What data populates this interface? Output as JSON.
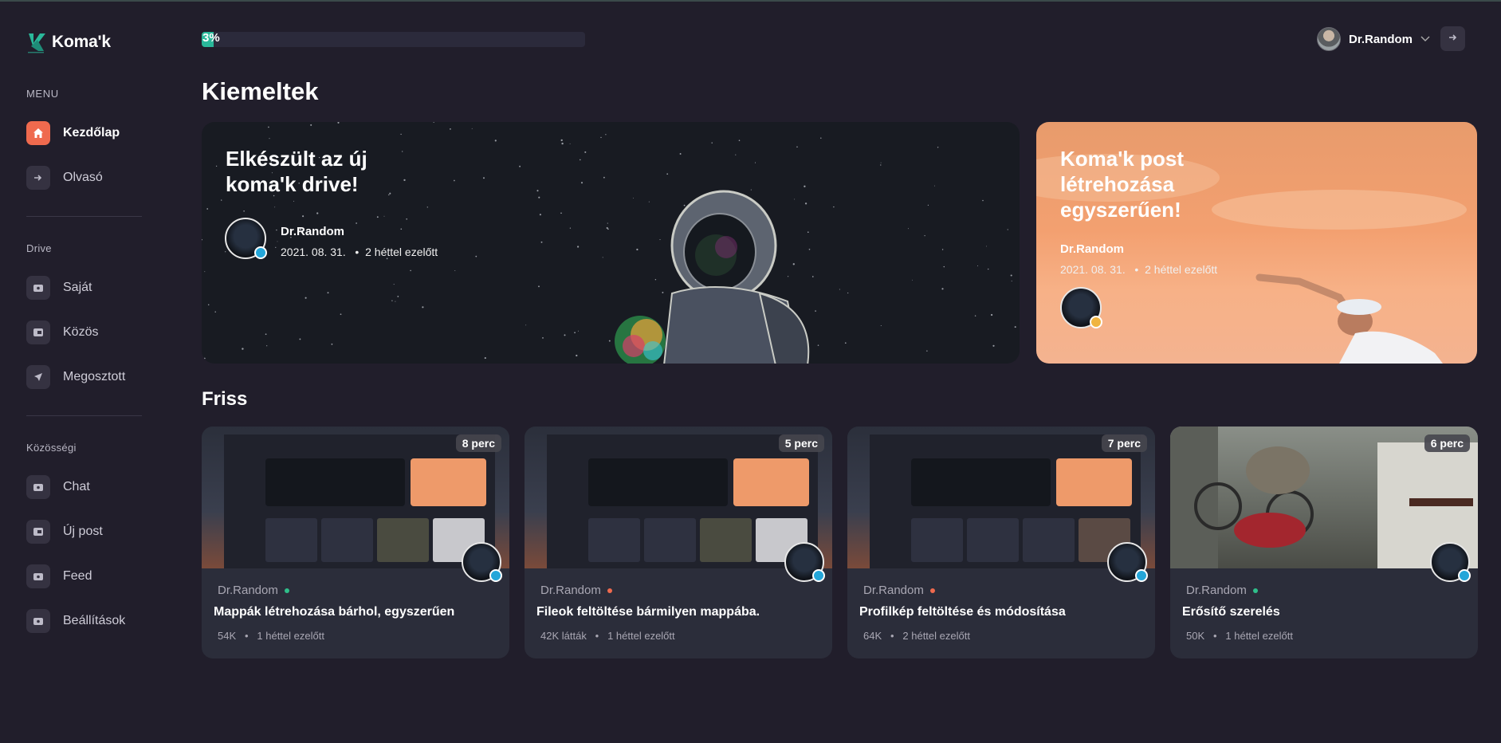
{
  "app": {
    "name": "Koma'k"
  },
  "progress": {
    "percent": 3,
    "label": "3%"
  },
  "user": {
    "name": "Dr.Random"
  },
  "sidebar": {
    "menu_label": "MENU",
    "menu_items": [
      {
        "label": "Kezdőlap",
        "icon": "home-icon",
        "active": true
      },
      {
        "label": "Olvasó",
        "icon": "arrow-right-icon",
        "active": false
      }
    ],
    "drive_label": "Drive",
    "drive_items": [
      {
        "label": "Saját",
        "icon": "folder-icon"
      },
      {
        "label": "Közös",
        "icon": "shared-folder-icon"
      },
      {
        "label": "Megosztott",
        "icon": "send-icon"
      }
    ],
    "community_label": "Közösségi",
    "community_items": [
      {
        "label": "Chat",
        "icon": "chat-icon"
      },
      {
        "label": "Új post",
        "icon": "new-post-icon"
      },
      {
        "label": "Feed",
        "icon": "feed-icon"
      },
      {
        "label": "Beállítások",
        "icon": "settings-icon"
      }
    ]
  },
  "headings": {
    "featured": "Kiemeltek",
    "recent": "Friss"
  },
  "featured": [
    {
      "title": "Elkészült az új koma'k drive!",
      "author": "Dr.Random",
      "date": "2021. 08. 31.",
      "ago": "2 héttel ezelőtt"
    },
    {
      "title": "Koma'k post létrehozása egyszerűen!",
      "author": "Dr.Random",
      "date": "2021. 08. 31.",
      "ago": "2 héttel ezelőtt"
    }
  ],
  "recent": [
    {
      "duration": "8 perc",
      "author": "Dr.Random",
      "status_color": "#2fbf8a",
      "title": "Mappák létrehozása bárhol, egyszerűen",
      "views": "54K",
      "ago": "1 héttel ezelőtt"
    },
    {
      "duration": "5 perc",
      "author": "Dr.Random",
      "status_color": "#ef6a4e",
      "title": "Fileok feltöltése bármilyen mappába.",
      "views": "42K látták",
      "ago": "1 héttel ezelőtt"
    },
    {
      "duration": "7 perc",
      "author": "Dr.Random",
      "status_color": "#ef6a4e",
      "title": "Profilkép feltöltése és módosítása",
      "views": "64K",
      "ago": "2 héttel ezelőtt"
    },
    {
      "duration": "6 perc",
      "author": "Dr.Random",
      "status_color": "#2fbf8a",
      "title": "Erősítő szerelés",
      "views": "50K",
      "ago": "1 héttel ezelőtt"
    }
  ],
  "colors": {
    "accent": "#ef6a4e",
    "progress": "#2ab89a",
    "verified": "#24a6d9"
  }
}
